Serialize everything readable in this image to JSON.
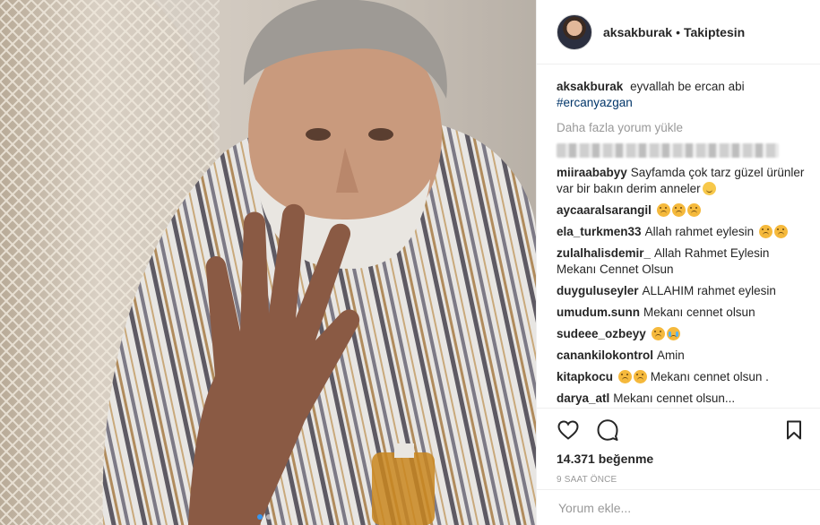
{
  "post": {
    "author": "aksakburak",
    "follow_state": "Takiptesin",
    "separator": "•",
    "caption": {
      "user": "aksakburak",
      "text": "eyvallah be ercan abi",
      "hashtag": "#ercanyazgan"
    },
    "load_more": "Daha fazla yorum yükle",
    "comments": [
      {
        "user": "miiraababyy",
        "text": "Sayfamda çok tarz güzel ürünler var bir bakın derim anneler",
        "emojis": [
          "smile"
        ]
      },
      {
        "user": "aycaaralsarangil",
        "text": "",
        "emojis": [
          "sad",
          "sad",
          "sad"
        ]
      },
      {
        "user": "ela_turkmen33",
        "text": "Allah rahmet eylesin",
        "emojis": [
          "sad",
          "sad"
        ]
      },
      {
        "user": "zulalhalisdemir_",
        "text": "Allah Rahmet Eylesin Mekanı Cennet Olsun",
        "emojis": []
      },
      {
        "user": "duyguluseyler",
        "text": "ALLAHIM rahmet eylesin",
        "emojis": []
      },
      {
        "user": "umudum.sunn",
        "text": "Mekanı cennet olsun",
        "emojis": []
      },
      {
        "user": "sudeee_ozbeyy",
        "text": "",
        "emojis": [
          "sad",
          "cry"
        ]
      },
      {
        "user": "canankilokontrol",
        "text": "Amin",
        "emojis": []
      },
      {
        "user": "kitapkocu",
        "text": "Mekanı cennet olsun .",
        "emojis_before": [
          "sad",
          "sad"
        ],
        "emojis": []
      },
      {
        "user": "darya_atl",
        "text": "Mekanı cennet olsun...",
        "emojis": []
      }
    ],
    "likes": "14.371 beğenme",
    "time": "9 SAAT ÖNCE",
    "comment_placeholder": "Yorum ekle...",
    "carousel": {
      "total": 2,
      "active": 0
    }
  },
  "icons": [
    "heart-icon",
    "comment-icon",
    "bookmark-icon"
  ],
  "colors": {
    "accent": "#3897f0",
    "hashtag": "#003569",
    "muted": "#999999",
    "text": "#262626"
  }
}
